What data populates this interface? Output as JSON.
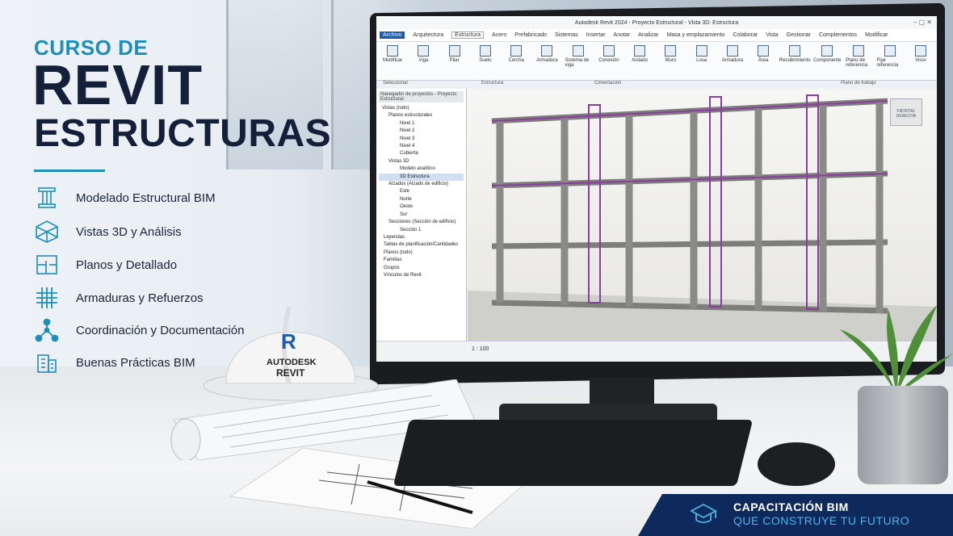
{
  "hero": {
    "line1": "CURSO DE",
    "line2": "REVIT",
    "line3": "ESTRUCTURAS"
  },
  "features": [
    {
      "icon": "column-icon",
      "label": "Modelado Estructural BIM"
    },
    {
      "icon": "cube-3d-icon",
      "label": "Vistas 3D y Análisis"
    },
    {
      "icon": "floor-plan-icon",
      "label": "Planos y Detallado"
    },
    {
      "icon": "rebar-grid-icon",
      "label": "Armaduras y Refuerzos"
    },
    {
      "icon": "network-nodes-icon",
      "label": "Coordinación y Documentación"
    },
    {
      "icon": "building-icon",
      "label": "Buenas Prácticas BIM"
    }
  ],
  "revit": {
    "window_title": "Autodesk Revit 2024 - Proyecto Estructural - Vista 3D: Estructura",
    "tabs": [
      "Archivo",
      "Arquitectura",
      "Estructura",
      "Acero",
      "Prefabricado",
      "Sistemas",
      "Insertar",
      "Anotar",
      "Analizar",
      "Masa y emplazamiento",
      "Colaborar",
      "Vista",
      "Gestionar",
      "Complementos",
      "Modificar"
    ],
    "ribbon": [
      "Modificar",
      "Viga",
      "Pilar",
      "Suelo",
      "Cercha",
      "Armadura",
      "Sistema de viga",
      "Conexión",
      "Aislado",
      "Muro",
      "Losa",
      "Armadura",
      "Área",
      "Recubrimiento",
      "Componente",
      "Plano de referencia",
      "Fijar referencia",
      "Visor"
    ],
    "ribbon_groups": [
      "Seleccionar",
      "Estructura",
      "Cimentación",
      "Plano de trabajo"
    ],
    "browser_title": "Navegador de proyectos - Proyecto Estructural",
    "browser": [
      "Vistas (todo)",
      "Planos estructurales",
      "Nivel 1",
      "Nivel 2",
      "Nivel 3",
      "Nivel 4",
      "Cubierta",
      "Vistas 3D",
      "Modelo analítico",
      "3D Estructura",
      "Alzados (Alzado de edificio)",
      "Este",
      "Norte",
      "Oeste",
      "Sur",
      "Secciones (Sección de edificio)",
      "Sección 1",
      "Leyendas",
      "Tablas de planificación/Cantidades",
      "Planos (todo)",
      "Familias",
      "Grupos",
      "Vínculos de Revit"
    ],
    "scale": "1 : 100",
    "viewcube": "FRONTAL  DERECHA"
  },
  "hat": {
    "brand": "AUTODESK",
    "product": "REVIT",
    "logo_letter": "R"
  },
  "banner": {
    "line1": "CAPACITACIÓN BIM",
    "line2": "QUE CONSTRUYE TU FUTURO"
  },
  "colors": {
    "accent": "#1d8fb8",
    "navy": "#14203a",
    "banner": "#0e2a5c",
    "rebar": "#8a3fa0"
  }
}
